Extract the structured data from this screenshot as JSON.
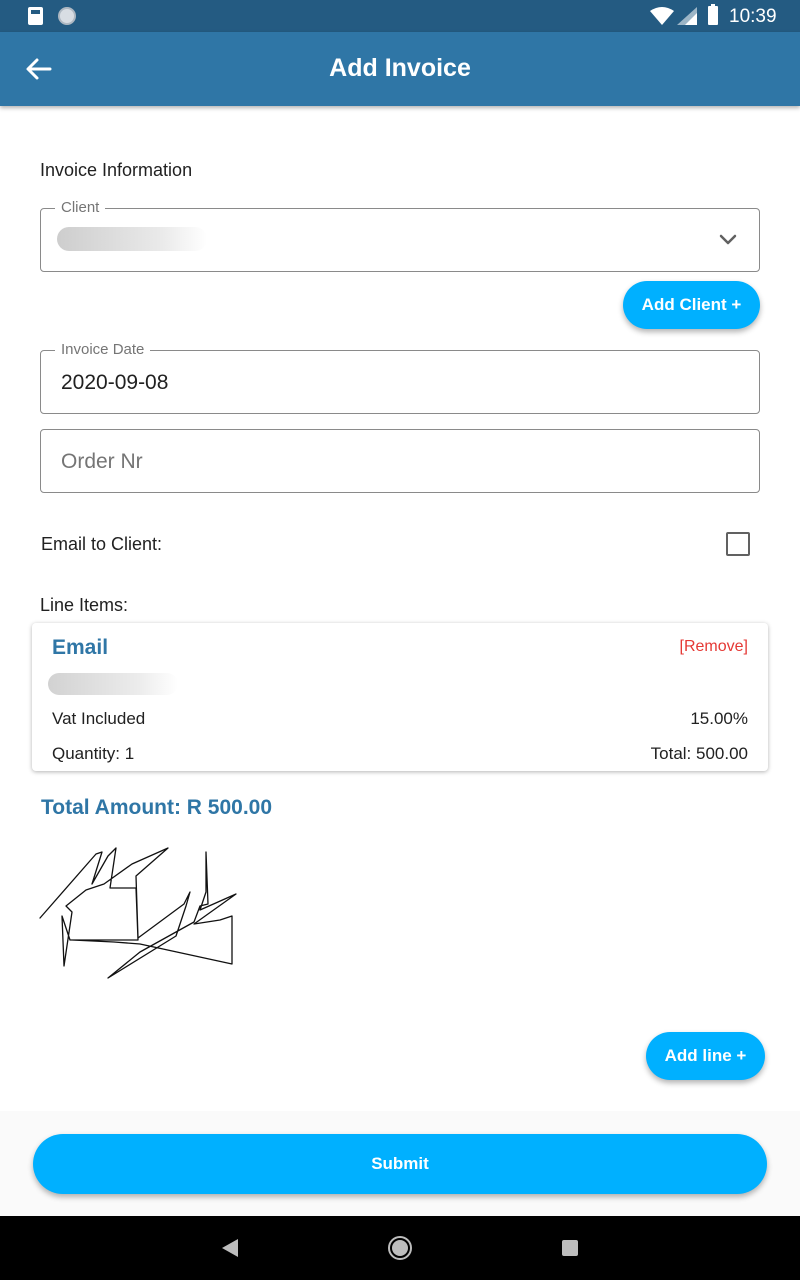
{
  "status_bar": {
    "time": "10:39",
    "icons": [
      "sd-card-icon",
      "circle-notification-icon",
      "wifi-icon",
      "signal-icon",
      "battery-icon"
    ]
  },
  "app_bar": {
    "title": "Add Invoice",
    "back_icon": "arrow-back-icon"
  },
  "form": {
    "section_label": "Invoice Information",
    "client": {
      "label": "Client",
      "value_obscured": true
    },
    "add_client_label": "Add Client +",
    "invoice_date": {
      "label": "Invoice Date",
      "value": "2020-09-08"
    },
    "order_nr": {
      "placeholder": "Order Nr",
      "value": ""
    },
    "email_to_client": {
      "label": "Email to Client:",
      "checked": false
    }
  },
  "line_items": {
    "label": "Line Items:",
    "items": [
      {
        "name": "Email",
        "remove_label": "[Remove]",
        "vat_label": "Vat Included",
        "vat_value": "15.00%",
        "quantity_text": "Quantity: 1",
        "total_text": "Total: 500.00"
      }
    ]
  },
  "total_amount": "Total Amount: R 500.00",
  "add_line_label": "Add line +",
  "submit_label": "Submit",
  "nav": {
    "icons": [
      "nav-back-icon",
      "nav-home-icon",
      "nav-recents-icon"
    ]
  },
  "colors": {
    "status_bar": "#245b82",
    "app_bar": "#2f76a6",
    "accent_button": "#00b0ff",
    "remove_text": "#e53935",
    "heading_text": "#2f76a6"
  }
}
